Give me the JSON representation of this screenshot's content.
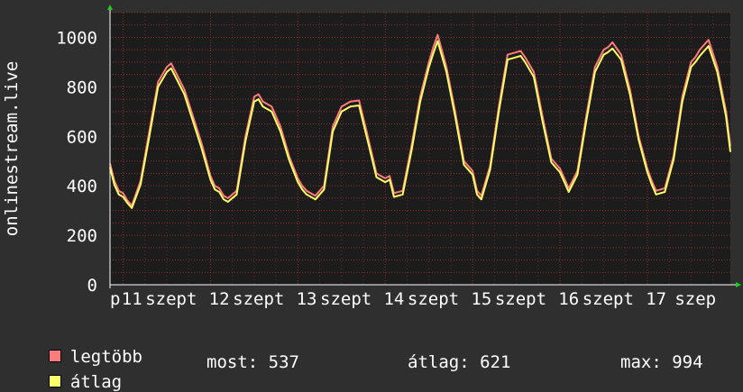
{
  "colors": {
    "background": "#2f2f2f",
    "plot_background": "#1c1c1c",
    "grid": "#8a3030",
    "axis": "#ffffff",
    "arrow": "#22cc22",
    "max_series": "#ff7b7b",
    "avg_series": "#ffff66"
  },
  "legend": {
    "max_label": "legtöbb",
    "avg_label": "átlag"
  },
  "stats": {
    "current": "most: 537",
    "average": "átlag: 621",
    "maximum": "max: 994"
  },
  "chart_data": {
    "type": "line",
    "ylabel": "onlinestream.live",
    "ylim": [
      0,
      1100
    ],
    "yticks": [
      0,
      200,
      400,
      600,
      800,
      1000
    ],
    "xlim": [
      10.85,
      17.95
    ],
    "xticks": [
      {
        "label": "p",
        "x": 10.85
      },
      {
        "label": "11",
        "x": 11.1
      },
      {
        "label": "szept",
        "x": 11.55
      },
      {
        "label": "12",
        "x": 12.1
      },
      {
        "label": "szept",
        "x": 12.55
      },
      {
        "label": "13",
        "x": 13.1
      },
      {
        "label": "szept",
        "x": 13.55
      },
      {
        "label": "14",
        "x": 14.1
      },
      {
        "label": "szept",
        "x": 14.55
      },
      {
        "label": "15",
        "x": 15.1
      },
      {
        "label": "szept",
        "x": 15.55
      },
      {
        "label": "16",
        "x": 16.1
      },
      {
        "label": "szept",
        "x": 16.55
      },
      {
        "label": "17",
        "x": 17.1
      },
      {
        "label": "szep",
        "x": 17.55
      }
    ],
    "grid": true,
    "series": [
      {
        "name": "legtöbb",
        "x": [
          10.85,
          10.9,
          10.95,
          11.0,
          11.05,
          11.1,
          11.2,
          11.3,
          11.4,
          11.5,
          11.55,
          11.6,
          11.7,
          11.8,
          11.9,
          12.0,
          12.05,
          12.1,
          12.15,
          12.2,
          12.3,
          12.4,
          12.5,
          12.55,
          12.6,
          12.7,
          12.8,
          12.9,
          13.0,
          13.05,
          13.1,
          13.2,
          13.3,
          13.4,
          13.5,
          13.6,
          13.7,
          13.8,
          13.9,
          14.0,
          14.05,
          14.1,
          14.2,
          14.3,
          14.4,
          14.5,
          14.55,
          14.6,
          14.7,
          14.8,
          14.9,
          15.0,
          15.05,
          15.1,
          15.2,
          15.3,
          15.4,
          15.5,
          15.55,
          15.6,
          15.7,
          15.8,
          15.9,
          16.0,
          16.05,
          16.1,
          16.2,
          16.3,
          16.4,
          16.5,
          16.55,
          16.6,
          16.7,
          16.8,
          16.9,
          17.0,
          17.05,
          17.1,
          17.2,
          17.3,
          17.4,
          17.5,
          17.55,
          17.6,
          17.7,
          17.8,
          17.9,
          17.95
        ],
        "values": [
          490,
          420,
          380,
          370,
          340,
          320,
          420,
          620,
          820,
          880,
          895,
          860,
          790,
          680,
          570,
          440,
          400,
          390,
          360,
          350,
          380,
          600,
          760,
          770,
          740,
          720,
          640,
          520,
          430,
          400,
          380,
          360,
          400,
          640,
          720,
          740,
          745,
          600,
          450,
          430,
          440,
          370,
          380,
          560,
          760,
          900,
          960,
          1010,
          880,
          700,
          500,
          460,
          380,
          360,
          480,
          720,
          930,
          940,
          945,
          920,
          860,
          680,
          510,
          470,
          430,
          390,
          460,
          680,
          880,
          950,
          960,
          980,
          930,
          790,
          600,
          470,
          420,
          380,
          390,
          520,
          760,
          900,
          920,
          950,
          990,
          880,
          700,
          560
        ]
      },
      {
        "name": "átlag",
        "x": [
          10.85,
          10.9,
          10.95,
          11.0,
          11.05,
          11.1,
          11.2,
          11.3,
          11.4,
          11.5,
          11.55,
          11.6,
          11.7,
          11.8,
          11.9,
          12.0,
          12.05,
          12.1,
          12.15,
          12.2,
          12.3,
          12.4,
          12.5,
          12.55,
          12.6,
          12.7,
          12.8,
          12.9,
          13.0,
          13.05,
          13.1,
          13.2,
          13.3,
          13.4,
          13.5,
          13.6,
          13.7,
          13.8,
          13.9,
          14.0,
          14.05,
          14.1,
          14.2,
          14.3,
          14.4,
          14.5,
          14.55,
          14.6,
          14.7,
          14.8,
          14.9,
          15.0,
          15.05,
          15.1,
          15.2,
          15.3,
          15.4,
          15.5,
          15.55,
          15.6,
          15.7,
          15.8,
          15.9,
          16.0,
          16.05,
          16.1,
          16.2,
          16.3,
          16.4,
          16.5,
          16.55,
          16.6,
          16.7,
          16.8,
          16.9,
          17.0,
          17.05,
          17.1,
          17.2,
          17.3,
          17.4,
          17.5,
          17.55,
          17.6,
          17.7,
          17.8,
          17.9,
          17.95
        ],
        "values": [
          475,
          405,
          365,
          355,
          330,
          310,
          405,
          600,
          800,
          860,
          875,
          840,
          770,
          660,
          550,
          425,
          385,
          375,
          345,
          335,
          365,
          580,
          740,
          750,
          720,
          700,
          620,
          505,
          415,
          385,
          365,
          345,
          385,
          620,
          700,
          720,
          725,
          580,
          435,
          415,
          425,
          355,
          365,
          540,
          740,
          880,
          935,
          985,
          860,
          680,
          485,
          445,
          365,
          345,
          465,
          700,
          910,
          920,
          925,
          900,
          840,
          660,
          495,
          455,
          415,
          375,
          445,
          660,
          860,
          930,
          940,
          955,
          910,
          770,
          585,
          455,
          405,
          365,
          375,
          505,
          740,
          880,
          900,
          925,
          965,
          860,
          680,
          537
        ]
      }
    ]
  }
}
